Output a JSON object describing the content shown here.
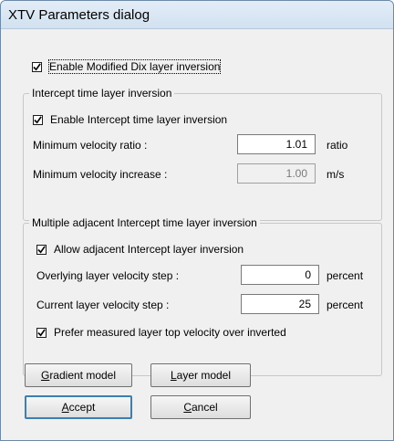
{
  "window": {
    "title": "XTV Parameters dialog"
  },
  "enable_dix": {
    "checked": true,
    "label": "Enable Modified Dix layer inversion"
  },
  "intercept_group": {
    "title": "Intercept time layer inversion",
    "enable_intercept": {
      "checked": true,
      "label": "Enable Intercept time layer inversion"
    },
    "min_velocity_ratio": {
      "label": "Minimum velocity ratio :",
      "value": "1.01",
      "unit": "ratio"
    },
    "min_velocity_increase": {
      "label": "Minimum velocity increase :",
      "value": "1.00",
      "unit": "m/s"
    }
  },
  "adjacent_group": {
    "title": "Multiple adjacent Intercept time layer inversion",
    "allow_adjacent": {
      "checked": true,
      "label": "Allow adjacent Intercept layer inversion"
    },
    "overlying_step": {
      "label": "Overlying layer velocity step :",
      "value": "0",
      "unit": "percent"
    },
    "current_step": {
      "label": "Current layer velocity step :",
      "value": "25",
      "unit": "percent"
    },
    "prefer_measured": {
      "checked": true,
      "label": "Prefer measured layer top velocity over inverted"
    }
  },
  "buttons": {
    "gradient_model": {
      "mnemonic": "G",
      "rest": "radient model"
    },
    "layer_model": {
      "mnemonic": "L",
      "rest": "ayer model"
    },
    "accept": {
      "mnemonic": "A",
      "rest": "ccept"
    },
    "cancel": {
      "mnemonic": "C",
      "rest": "ancel"
    }
  }
}
